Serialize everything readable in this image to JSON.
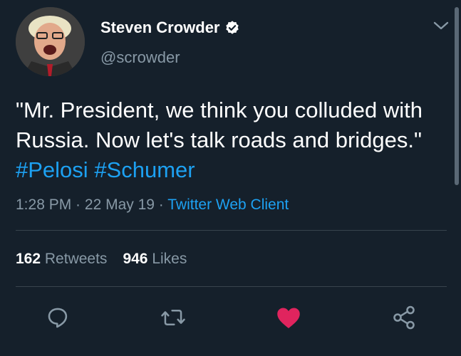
{
  "user": {
    "display_name": "Steven Crowder",
    "handle": "@scrowder"
  },
  "tweet": {
    "text_before": "\"Mr. President, we think you colluded with Russia. Now let's talk roads and bridges.\" ",
    "hashtags": [
      "#Pelosi",
      "#Schumer"
    ],
    "time": "1:28 PM",
    "sep1": " · ",
    "date": "22 May 19",
    "sep2": " · ",
    "client": "Twitter Web Client"
  },
  "stats": {
    "retweets_count": "162",
    "retweets_label": "Retweets",
    "likes_count": "946",
    "likes_label": "Likes"
  },
  "icons": {
    "verified": "verified-badge-icon",
    "menu": "chevron-down-icon",
    "reply": "reply-bubble-icon",
    "retweet": "retweet-icon",
    "like": "heart-filled-icon",
    "share": "share-nodes-icon"
  },
  "colors": {
    "background": "#15202b",
    "secondary_text": "#8899a6",
    "link": "#1da1f2",
    "like": "#e0245e"
  }
}
